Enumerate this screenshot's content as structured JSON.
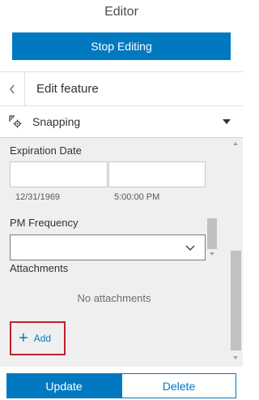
{
  "header": {
    "title": "Editor"
  },
  "toolbar": {
    "stop_editing_label": "Stop Editing"
  },
  "feature": {
    "title": "Edit feature",
    "back_icon": "chevron-left-icon"
  },
  "snapping": {
    "label": "Snapping",
    "icon": "snapping-icon"
  },
  "form": {
    "expiration": {
      "label": "Expiration Date",
      "date_value": "12/31/1969",
      "time_value": "5:00:00 PM"
    },
    "pm_frequency": {
      "label": "PM Frequency",
      "value": ""
    },
    "attachments": {
      "label": "Attachments",
      "empty_text": "No attachments",
      "add_label": "Add"
    }
  },
  "actions": {
    "update_label": "Update",
    "delete_label": "Delete"
  },
  "colors": {
    "accent": "#0079c1",
    "highlight": "#c0202b",
    "panel_bg": "#efefef"
  }
}
